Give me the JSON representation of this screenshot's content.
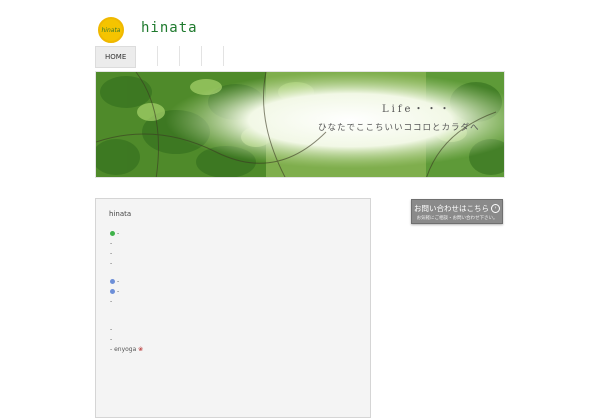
{
  "header": {
    "logo_text": "hinata",
    "site_title": "hinata"
  },
  "nav": {
    "items": [
      {
        "label": "HOME"
      }
    ]
  },
  "hero": {
    "caption_life": "Life・・・",
    "caption_sub": "ひなたでここちいいココロとカラダへ"
  },
  "main": {
    "title": "hinata",
    "lines": [
      "-",
      "-",
      "-",
      "-",
      "-",
      "-",
      "-",
      "-",
      "-",
      "- enyoga"
    ]
  },
  "contact": {
    "label": "お問い合わせはこちら",
    "sub": "お気軽にご相談・お問い合わせ下さい。"
  },
  "colors": {
    "accent": "#1f7a2e",
    "logo": "#f5c400",
    "button": "#8a8a8a"
  }
}
